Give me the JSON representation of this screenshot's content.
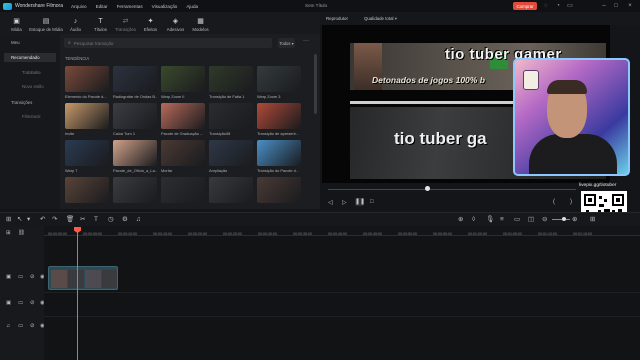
{
  "app": {
    "name": "Wondershare Filmora",
    "menu": [
      "Arquivo",
      "Editar",
      "Ferramentas",
      "Visualização",
      "Ajuda"
    ],
    "document_title": "Sem Título",
    "buy_label": "Comprar"
  },
  "toolbar": {
    "items": [
      {
        "label": "Mídia",
        "icon": "media-icon"
      },
      {
        "label": "Estoque de Mídia",
        "icon": "stock-media-icon"
      },
      {
        "label": "Áudio",
        "icon": "audio-icon"
      },
      {
        "label": "Títulos",
        "icon": "titles-icon"
      },
      {
        "label": "Transições",
        "icon": "transitions-icon"
      },
      {
        "label": "Efeitos",
        "icon": "effects-icon"
      },
      {
        "label": "Adesivos",
        "icon": "stickers-icon"
      },
      {
        "label": "Modelos",
        "icon": "templates-icon"
      }
    ],
    "active_index": 4
  },
  "sidebar": {
    "items": [
      {
        "label": "Meu"
      },
      {
        "label": "Recomendado"
      },
      {
        "label": "TrabBalte"
      },
      {
        "label": "Novo estilo"
      },
      {
        "label": "Transições"
      },
      {
        "label": "Filmstock"
      }
    ],
    "selected_index": 1
  },
  "panel": {
    "search_placeholder": "Pesquisar transição",
    "filter_label": "Todos",
    "section_label": "TENDÊNCIA",
    "transitions": [
      {
        "caption": "Elemento do Pacote d...",
        "color": "#7a4a3a"
      },
      {
        "caption": "Radiografar de Ondas B...",
        "color": "#2b3340"
      },
      {
        "caption": "Warp Zoom II",
        "color": "#3a4a2c"
      },
      {
        "caption": "Transição de Fatia 1",
        "color": "#2f3a2a"
      },
      {
        "caption": "Warp Zoom 3",
        "color": "#343c3a"
      },
      {
        "caption": "Invite",
        "color": "#c89a6a"
      },
      {
        "caption": "Caixa Turn 1",
        "color": "#3b3d44"
      },
      {
        "caption": "Pacote de Graduação ...",
        "color": "#b86a5a"
      },
      {
        "caption": "Transição08",
        "color": "#2a2c30"
      },
      {
        "caption": "Transição de apresent...",
        "color": "#b04a38"
      },
      {
        "caption": "Warp 7",
        "color": "#2b3b52"
      },
      {
        "caption": "Pacote_de_Ofício_a_La...",
        "color": "#d2a28a"
      },
      {
        "caption": "Morfar",
        "color": "#4a3a34"
      },
      {
        "caption": "Ampliação",
        "color": "#2f3848"
      },
      {
        "caption": "Transição do Pacote d...",
        "color": "#4a90c8"
      },
      {
        "caption": "",
        "color": "#5a4438"
      },
      {
        "caption": "",
        "color": "#3a3c40"
      },
      {
        "caption": "",
        "color": "#2c2e32"
      },
      {
        "caption": "",
        "color": "#3a3a3e"
      },
      {
        "caption": "",
        "color": "#4a3a36"
      }
    ]
  },
  "preview": {
    "tab_label": "Reprodutor",
    "quality_label": "Qualidade total",
    "banner_title": "tio tuber gamer",
    "banner_subtitle": "Detonados de jogos 100% b",
    "banner2_title": "tio tuber ga",
    "qr_label": "livepix.gg/tiotuber"
  },
  "timeline": {
    "ruler": [
      "00:00:00:00",
      "00:00:05:00",
      "00:00:10:00",
      "00:00:15:00",
      "00:00:20:00",
      "00:00:25:00",
      "00:00:30:00",
      "00:00:35:00",
      "00:00:40:00",
      "00:00:45:00",
      "00:00:50:00",
      "00:00:55:00",
      "00:01:00:00",
      "00:01:05:00",
      "00:01:10:00",
      "00:01:15:00"
    ],
    "tracks": [
      "video-track-2",
      "video-track-1",
      "audio-track-1"
    ]
  },
  "colors": {
    "accent": "#e24a3b",
    "playhead": "#ff5b4a",
    "clip": "#2c4a53",
    "webcam_border": "#8cc7ff"
  }
}
